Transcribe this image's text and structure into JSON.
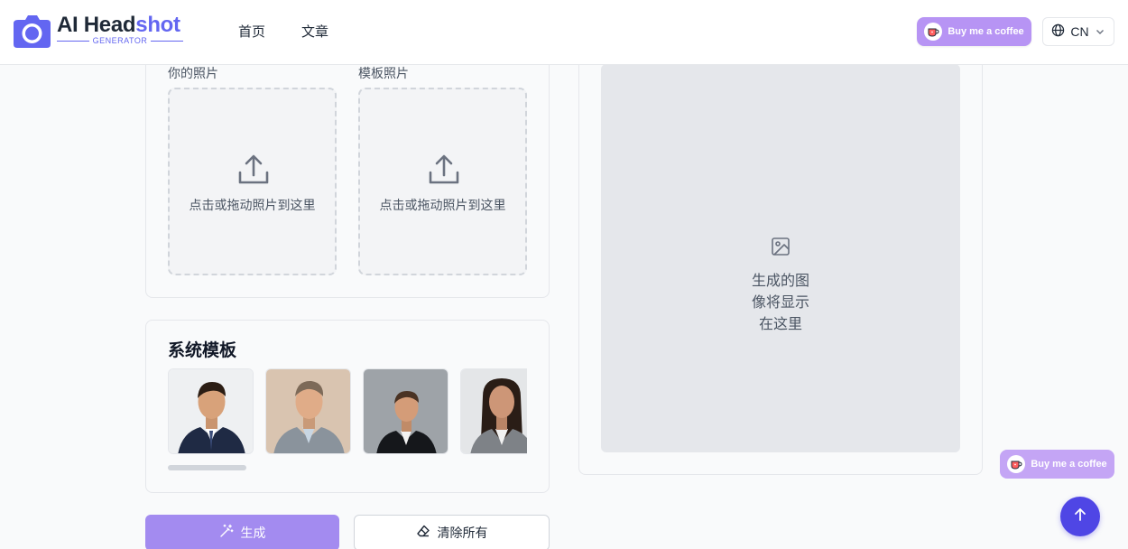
{
  "header": {
    "logo": {
      "main_prefix": "AI Head",
      "main_accent": "shot",
      "sub": "GENERATOR"
    },
    "nav": [
      {
        "label": "首页"
      },
      {
        "label": "文章"
      }
    ],
    "coffee_label": "Buy me a coffee",
    "language": "CN"
  },
  "upload": {
    "your_photo_label": "你的照片",
    "template_photo_label": "模板照片",
    "drop_text": "点击或拖动照片到这里"
  },
  "templates": {
    "title": "系统模板"
  },
  "output": {
    "placeholder_lines": [
      "生成的图",
      "像将显示",
      "在这里"
    ]
  },
  "actions": {
    "generate_label": "生成",
    "clear_label": "清除所有"
  },
  "floating": {
    "coffee_label": "Buy me a coffee"
  },
  "colors": {
    "brand": "#6366f1",
    "coffee": "#b794f4",
    "generate": "#a38bf0",
    "scroll_top": "#4f46e5"
  }
}
